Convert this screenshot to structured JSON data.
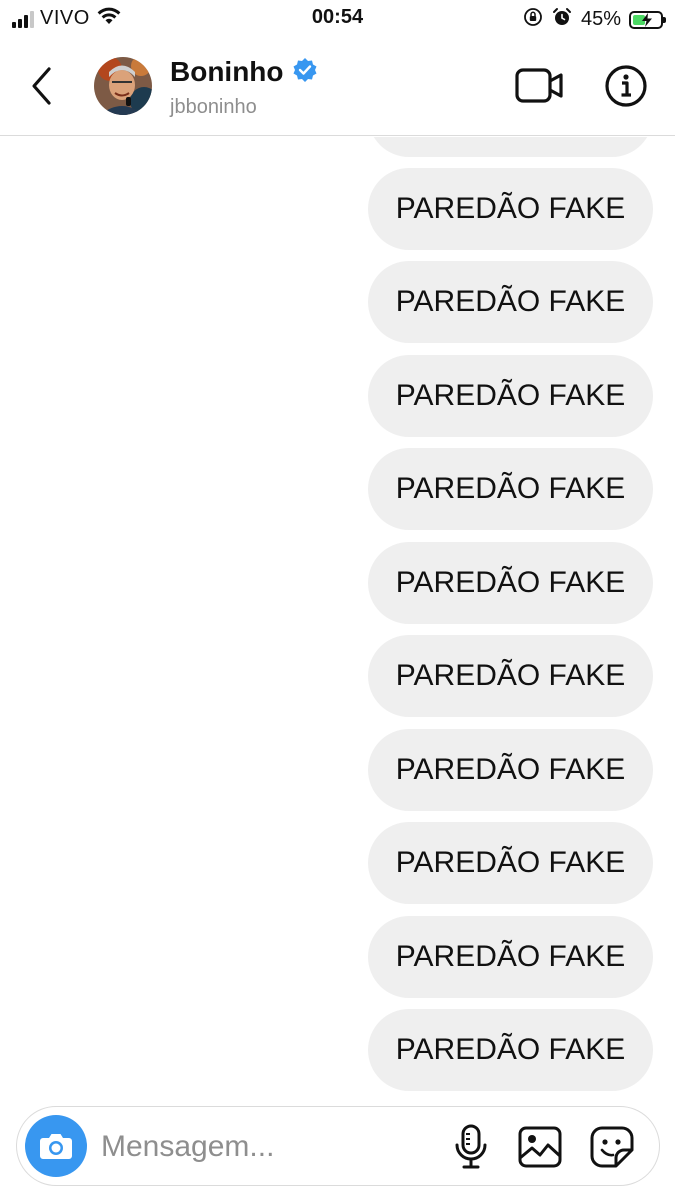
{
  "status_bar": {
    "carrier": "VIVO",
    "time": "00:54",
    "battery_percent": "45%",
    "battery_level": 0.45,
    "icons": [
      "signal-icon",
      "wifi-icon",
      "orientation-lock-icon",
      "alarm-icon",
      "battery-icon"
    ]
  },
  "header": {
    "name": "Boninho",
    "username": "jbboninho",
    "verified": true,
    "icons": [
      "back-chevron-icon",
      "verified-badge-icon",
      "video-call-icon",
      "info-icon"
    ]
  },
  "messages": [
    {
      "text": "PAREDÃO FAKE"
    },
    {
      "text": "PAREDÃO FAKE"
    },
    {
      "text": "PAREDÃO FAKE"
    },
    {
      "text": "PAREDÃO FAKE"
    },
    {
      "text": "PAREDÃO FAKE"
    },
    {
      "text": "PAREDÃO FAKE"
    },
    {
      "text": "PAREDÃO FAKE"
    },
    {
      "text": "PAREDÃO FAKE"
    },
    {
      "text": "PAREDÃO FAKE"
    },
    {
      "text": "PAREDÃO FAKE"
    }
  ],
  "composer": {
    "placeholder": "Mensagem...",
    "icons": [
      "camera-icon",
      "microphone-icon",
      "gallery-icon",
      "sticker-icon"
    ]
  },
  "colors": {
    "bubble_bg": "#efefef",
    "accent_blue": "#3897f0",
    "battery_green": "#4cd964",
    "muted_text": "#8e8e8e"
  }
}
